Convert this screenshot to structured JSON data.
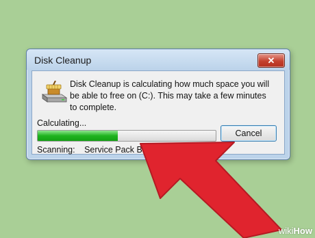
{
  "dialog": {
    "title": "Disk Cleanup",
    "close_symbol": "✕",
    "icon": "disk-cleanup-icon",
    "message": "Disk Cleanup is calculating how much space you will be able to free on  (C:). This may take a few minutes to complete.",
    "status_label": "Calculating...",
    "progress_percent": 45,
    "cancel_label": "Cancel",
    "scanning_label": "Scanning:",
    "scanning_item": "Service Pack Ba"
  },
  "overlay": {
    "arrow_color": "#e0242e",
    "arrow_icon": "pointer-arrow"
  },
  "watermark": {
    "wiki": "wiki",
    "how": "How"
  },
  "colors": {
    "background": "#a9cf96",
    "progress_green": "#1fb31f",
    "close_red": "#c4412f"
  }
}
